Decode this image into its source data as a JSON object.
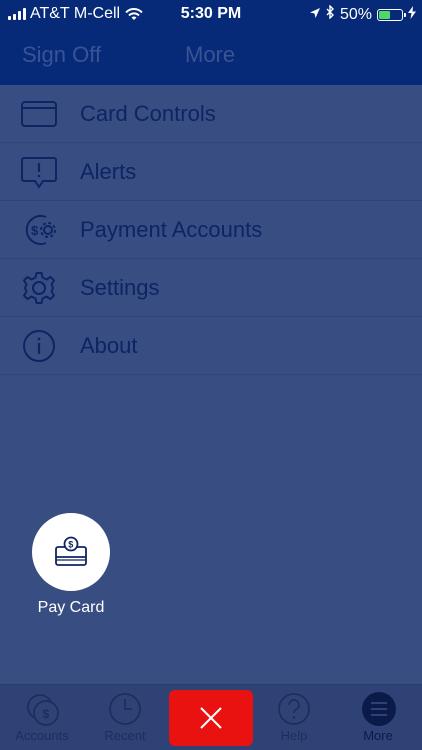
{
  "status_bar": {
    "carrier": "AT&T M-Cell",
    "time": "5:30 PM",
    "battery": "50%",
    "battery_level": 0.5,
    "battery_color": "#4cd964"
  },
  "header": {
    "sign_off": "Sign Off",
    "title": "More"
  },
  "menu": {
    "items": [
      {
        "label": "Card Controls",
        "icon": "card-icon"
      },
      {
        "label": "Alerts",
        "icon": "alert-bubble-icon"
      },
      {
        "label": "Payment Accounts",
        "icon": "dollar-gear-icon"
      },
      {
        "label": "Settings",
        "icon": "gear-icon"
      },
      {
        "label": "About",
        "icon": "info-icon"
      }
    ]
  },
  "pay_card": {
    "label": "Pay Card",
    "icon": "pay-card-icon"
  },
  "tab_bar": {
    "tabs": [
      {
        "label": "Accounts",
        "icon": "accounts-icon"
      },
      {
        "label": "Recent",
        "icon": "clock-icon"
      },
      {
        "label": "Help",
        "icon": "help-icon"
      },
      {
        "label": "More",
        "icon": "hamburger-icon"
      }
    ],
    "close_icon": "close-icon",
    "close_color": "#ea1111"
  },
  "colors": {
    "header_bg": "#062a78",
    "overlay_bg": "#384e82",
    "menu_text": "#0e2463"
  }
}
